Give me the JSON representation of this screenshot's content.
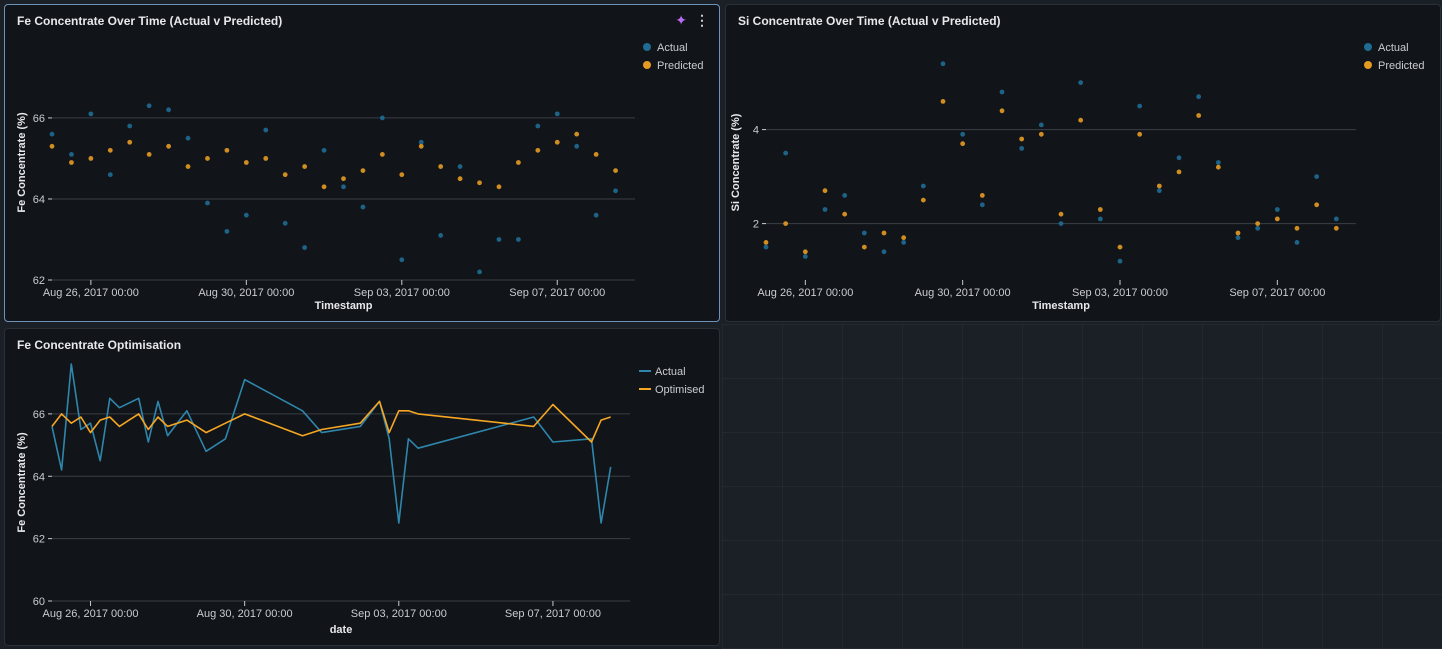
{
  "colors": {
    "actual": "#1f6b94",
    "actual_line": "#2f86ad",
    "predicted": "#e49a23",
    "optimised": "#f5a623",
    "grid": "#3a3f46",
    "axis_text": "#c9ccd1"
  },
  "panels": {
    "fe": {
      "title": "Fe Concentrate Over Time (Actual v Predicted)",
      "icons": [
        "sparkle-icon",
        "more-vert-icon"
      ]
    },
    "si": {
      "title": "Si Concentrate Over Time (Actual v Predicted)"
    },
    "opt": {
      "title": "Fe Concentrate Optimisation"
    }
  },
  "chart_data": [
    {
      "id": "fe",
      "type": "scatter",
      "title": "Fe Concentrate Over Time (Actual v Predicted)",
      "xlabel": "Timestamp",
      "ylabel": "Fe Concentrate (%)",
      "x_range": [
        "2017-08-25",
        "2017-09-09"
      ],
      "ylim": [
        62,
        67.8
      ],
      "yticks": [
        62,
        64,
        66
      ],
      "xticks": [
        {
          "date": "2017-08-26",
          "label": "Aug 26, 2017 00:00"
        },
        {
          "date": "2017-08-30",
          "label": "Aug 30, 2017 00:00"
        },
        {
          "date": "2017-09-03",
          "label": "Sep 03, 2017 00:00"
        },
        {
          "date": "2017-09-07",
          "label": "Sep 07, 2017 00:00"
        }
      ],
      "legend": {
        "position": "top-right",
        "entries": [
          "Actual",
          "Predicted"
        ]
      },
      "series": [
        {
          "name": "Actual",
          "values": [
            [
              "2017-08-25",
              65.6
            ],
            [
              "2017-08-25 12:00",
              65.1
            ],
            [
              "2017-08-26",
              66.1
            ],
            [
              "2017-08-26 12:00",
              64.6
            ],
            [
              "2017-08-27",
              65.8
            ],
            [
              "2017-08-27 12:00",
              66.3
            ],
            [
              "2017-08-28",
              66.2
            ],
            [
              "2017-08-28 12:00",
              65.5
            ],
            [
              "2017-08-29",
              63.9
            ],
            [
              "2017-08-29 12:00",
              63.2
            ],
            [
              "2017-08-30",
              63.6
            ],
            [
              "2017-08-30 12:00",
              65.7
            ],
            [
              "2017-08-31",
              63.4
            ],
            [
              "2017-08-31 12:00",
              62.8
            ],
            [
              "2017-09-01",
              65.2
            ],
            [
              "2017-09-01 12:00",
              64.3
            ],
            [
              "2017-09-02",
              63.8
            ],
            [
              "2017-09-02 12:00",
              66.0
            ],
            [
              "2017-09-03",
              62.5
            ],
            [
              "2017-09-03 12:00",
              65.4
            ],
            [
              "2017-09-04",
              63.1
            ],
            [
              "2017-09-04 12:00",
              64.8
            ],
            [
              "2017-09-05",
              62.2
            ],
            [
              "2017-09-05 12:00",
              63.0
            ],
            [
              "2017-09-06",
              63.0
            ],
            [
              "2017-09-06 12:00",
              65.8
            ],
            [
              "2017-09-07",
              66.1
            ],
            [
              "2017-09-07 12:00",
              65.3
            ],
            [
              "2017-09-08",
              63.6
            ],
            [
              "2017-09-08 12:00",
              64.2
            ]
          ]
        },
        {
          "name": "Predicted",
          "values": [
            [
              "2017-08-25",
              65.3
            ],
            [
              "2017-08-25 12:00",
              64.9
            ],
            [
              "2017-08-26",
              65.0
            ],
            [
              "2017-08-26 12:00",
              65.2
            ],
            [
              "2017-08-27",
              65.4
            ],
            [
              "2017-08-27 12:00",
              65.1
            ],
            [
              "2017-08-28",
              65.3
            ],
            [
              "2017-08-28 12:00",
              64.8
            ],
            [
              "2017-08-29",
              65.0
            ],
            [
              "2017-08-29 12:00",
              65.2
            ],
            [
              "2017-08-30",
              64.9
            ],
            [
              "2017-08-30 12:00",
              65.0
            ],
            [
              "2017-08-31",
              64.6
            ],
            [
              "2017-08-31 12:00",
              64.8
            ],
            [
              "2017-09-01",
              64.3
            ],
            [
              "2017-09-01 12:00",
              64.5
            ],
            [
              "2017-09-02",
              64.7
            ],
            [
              "2017-09-02 12:00",
              65.1
            ],
            [
              "2017-09-03",
              64.6
            ],
            [
              "2017-09-03 12:00",
              65.3
            ],
            [
              "2017-09-04",
              64.8
            ],
            [
              "2017-09-04 12:00",
              64.5
            ],
            [
              "2017-09-05",
              64.4
            ],
            [
              "2017-09-05 12:00",
              64.3
            ],
            [
              "2017-09-06",
              64.9
            ],
            [
              "2017-09-06 12:00",
              65.2
            ],
            [
              "2017-09-07",
              65.4
            ],
            [
              "2017-09-07 12:00",
              65.6
            ],
            [
              "2017-09-08",
              65.1
            ],
            [
              "2017-09-08 12:00",
              64.7
            ]
          ]
        }
      ]
    },
    {
      "id": "si",
      "type": "scatter",
      "title": "Si Concentrate Over Time (Actual v Predicted)",
      "xlabel": "Timestamp",
      "ylabel": "Si Concentrate (%)",
      "x_range": [
        "2017-08-25",
        "2017-09-09"
      ],
      "ylim": [
        0.8,
        5.8
      ],
      "yticks": [
        2,
        4
      ],
      "xticks": [
        {
          "date": "2017-08-26",
          "label": "Aug 26, 2017 00:00"
        },
        {
          "date": "2017-08-30",
          "label": "Aug 30, 2017 00:00"
        },
        {
          "date": "2017-09-03",
          "label": "Sep 03, 2017 00:00"
        },
        {
          "date": "2017-09-07",
          "label": "Sep 07, 2017 00:00"
        }
      ],
      "legend": {
        "position": "top-right",
        "entries": [
          "Actual",
          "Predicted"
        ]
      },
      "series": [
        {
          "name": "Actual",
          "values": [
            [
              "2017-08-25",
              1.5
            ],
            [
              "2017-08-25 12:00",
              3.5
            ],
            [
              "2017-08-26",
              1.3
            ],
            [
              "2017-08-26 12:00",
              2.3
            ],
            [
              "2017-08-27",
              2.6
            ],
            [
              "2017-08-27 12:00",
              1.8
            ],
            [
              "2017-08-28",
              1.4
            ],
            [
              "2017-08-28 12:00",
              1.6
            ],
            [
              "2017-08-29",
              2.8
            ],
            [
              "2017-08-29 12:00",
              5.4
            ],
            [
              "2017-08-30",
              3.9
            ],
            [
              "2017-08-30 12:00",
              2.4
            ],
            [
              "2017-08-31",
              4.8
            ],
            [
              "2017-08-31 12:00",
              3.6
            ],
            [
              "2017-09-01",
              4.1
            ],
            [
              "2017-09-01 12:00",
              2.0
            ],
            [
              "2017-09-02",
              5.0
            ],
            [
              "2017-09-02 12:00",
              2.1
            ],
            [
              "2017-09-03",
              1.2
            ],
            [
              "2017-09-03 12:00",
              4.5
            ],
            [
              "2017-09-04",
              2.7
            ],
            [
              "2017-09-04 12:00",
              3.4
            ],
            [
              "2017-09-05",
              4.7
            ],
            [
              "2017-09-05 12:00",
              3.3
            ],
            [
              "2017-09-06",
              1.7
            ],
            [
              "2017-09-06 12:00",
              1.9
            ],
            [
              "2017-09-07",
              2.3
            ],
            [
              "2017-09-07 12:00",
              1.6
            ],
            [
              "2017-09-08",
              3.0
            ],
            [
              "2017-09-08 12:00",
              2.1
            ]
          ]
        },
        {
          "name": "Predicted",
          "values": [
            [
              "2017-08-25",
              1.6
            ],
            [
              "2017-08-25 12:00",
              2.0
            ],
            [
              "2017-08-26",
              1.4
            ],
            [
              "2017-08-26 12:00",
              2.7
            ],
            [
              "2017-08-27",
              2.2
            ],
            [
              "2017-08-27 12:00",
              1.5
            ],
            [
              "2017-08-28",
              1.8
            ],
            [
              "2017-08-28 12:00",
              1.7
            ],
            [
              "2017-08-29",
              2.5
            ],
            [
              "2017-08-29 12:00",
              4.6
            ],
            [
              "2017-08-30",
              3.7
            ],
            [
              "2017-08-30 12:00",
              2.6
            ],
            [
              "2017-08-31",
              4.4
            ],
            [
              "2017-08-31 12:00",
              3.8
            ],
            [
              "2017-09-01",
              3.9
            ],
            [
              "2017-09-01 12:00",
              2.2
            ],
            [
              "2017-09-02",
              4.2
            ],
            [
              "2017-09-02 12:00",
              2.3
            ],
            [
              "2017-09-03",
              1.5
            ],
            [
              "2017-09-03 12:00",
              3.9
            ],
            [
              "2017-09-04",
              2.8
            ],
            [
              "2017-09-04 12:00",
              3.1
            ],
            [
              "2017-09-05",
              4.3
            ],
            [
              "2017-09-05 12:00",
              3.2
            ],
            [
              "2017-09-06",
              1.8
            ],
            [
              "2017-09-06 12:00",
              2.0
            ],
            [
              "2017-09-07",
              2.1
            ],
            [
              "2017-09-07 12:00",
              1.9
            ],
            [
              "2017-09-08",
              2.4
            ],
            [
              "2017-09-08 12:00",
              1.9
            ]
          ]
        }
      ]
    },
    {
      "id": "opt",
      "type": "line",
      "title": "Fe Concentrate Optimisation",
      "xlabel": "date",
      "ylabel": "Fe Concentrate (%)",
      "x_range": [
        "2017-08-25",
        "2017-09-09"
      ],
      "ylim": [
        60,
        67.6
      ],
      "yticks": [
        60,
        62,
        64,
        66
      ],
      "xticks": [
        {
          "date": "2017-08-26",
          "label": "Aug 26, 2017 00:00"
        },
        {
          "date": "2017-08-30",
          "label": "Aug 30, 2017 00:00"
        },
        {
          "date": "2017-09-03",
          "label": "Sep 03, 2017 00:00"
        },
        {
          "date": "2017-09-07",
          "label": "Sep 07, 2017 00:00"
        }
      ],
      "legend": {
        "position": "top-right",
        "entries": [
          "Actual",
          "Optimised"
        ]
      },
      "series": [
        {
          "name": "Actual",
          "values": [
            [
              "2017-08-25",
              65.6
            ],
            [
              "2017-08-25 06:00",
              64.2
            ],
            [
              "2017-08-25 12:00",
              67.6
            ],
            [
              "2017-08-25 18:00",
              65.5
            ],
            [
              "2017-08-26",
              65.7
            ],
            [
              "2017-08-26 06:00",
              64.5
            ],
            [
              "2017-08-26 12:00",
              66.5
            ],
            [
              "2017-08-26 18:00",
              66.2
            ],
            [
              "2017-08-27 06:00",
              66.5
            ],
            [
              "2017-08-27 12:00",
              65.1
            ],
            [
              "2017-08-27 18:00",
              66.4
            ],
            [
              "2017-08-28",
              65.3
            ],
            [
              "2017-08-28 12:00",
              66.1
            ],
            [
              "2017-08-29",
              64.8
            ],
            [
              "2017-08-29 12:00",
              65.2
            ],
            [
              "2017-08-30",
              67.1
            ],
            [
              "2017-08-31 12:00",
              66.1
            ],
            [
              "2017-09-01",
              65.4
            ],
            [
              "2017-09-02",
              65.6
            ],
            [
              "2017-09-02 12:00",
              66.4
            ],
            [
              "2017-09-02 18:00",
              65.2
            ],
            [
              "2017-09-03",
              62.5
            ],
            [
              "2017-09-03 06:00",
              65.2
            ],
            [
              "2017-09-03 12:00",
              64.9
            ],
            [
              "2017-09-06 12:00",
              65.9
            ],
            [
              "2017-09-07",
              65.1
            ],
            [
              "2017-09-08",
              65.2
            ],
            [
              "2017-09-08 06:00",
              62.5
            ],
            [
              "2017-09-08 12:00",
              64.3
            ]
          ]
        },
        {
          "name": "Optimised",
          "values": [
            [
              "2017-08-25",
              65.6
            ],
            [
              "2017-08-25 06:00",
              66.0
            ],
            [
              "2017-08-25 12:00",
              65.7
            ],
            [
              "2017-08-25 18:00",
              65.9
            ],
            [
              "2017-08-26",
              65.4
            ],
            [
              "2017-08-26 06:00",
              65.8
            ],
            [
              "2017-08-26 12:00",
              65.9
            ],
            [
              "2017-08-26 18:00",
              65.6
            ],
            [
              "2017-08-27 06:00",
              66.0
            ],
            [
              "2017-08-27 12:00",
              65.5
            ],
            [
              "2017-08-27 18:00",
              65.9
            ],
            [
              "2017-08-28",
              65.6
            ],
            [
              "2017-08-28 12:00",
              65.8
            ],
            [
              "2017-08-29",
              65.4
            ],
            [
              "2017-08-29 12:00",
              65.7
            ],
            [
              "2017-08-30",
              66.0
            ],
            [
              "2017-08-31 12:00",
              65.3
            ],
            [
              "2017-09-01",
              65.5
            ],
            [
              "2017-09-02",
              65.7
            ],
            [
              "2017-09-02 12:00",
              66.4
            ],
            [
              "2017-09-02 18:00",
              65.4
            ],
            [
              "2017-09-03",
              66.1
            ],
            [
              "2017-09-03 06:00",
              66.1
            ],
            [
              "2017-09-03 12:00",
              66.0
            ],
            [
              "2017-09-06 12:00",
              65.6
            ],
            [
              "2017-09-07",
              66.3
            ],
            [
              "2017-09-08",
              65.1
            ],
            [
              "2017-09-08 06:00",
              65.8
            ],
            [
              "2017-09-08 12:00",
              65.9
            ]
          ]
        }
      ]
    }
  ]
}
